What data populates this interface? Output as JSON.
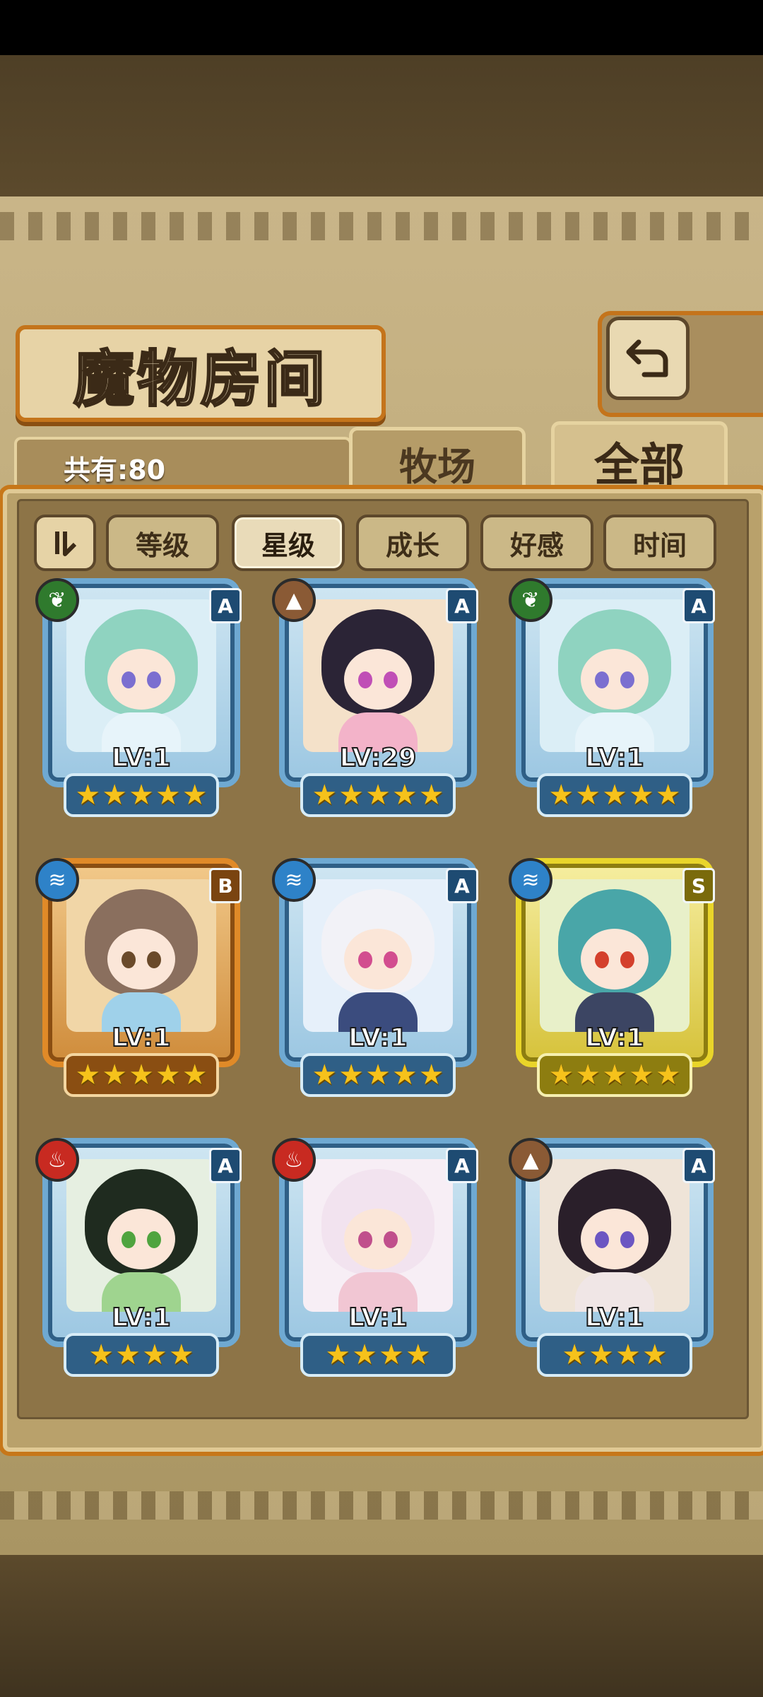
{
  "title": "魔物房间",
  "count_label": "共有:80",
  "tabs": {
    "ranch": "牧场",
    "all": "全部"
  },
  "sort_buttons": [
    "等级",
    "星级",
    "成长",
    "好感",
    "时间"
  ],
  "active_sort": "星级",
  "monsters": [
    {
      "element": "nature-icon",
      "rank": "A",
      "level": "LV:1",
      "stars": 5,
      "frame": "blue"
    },
    {
      "element": "earth-icon",
      "rank": "A",
      "level": "LV:29",
      "stars": 5,
      "frame": "blue"
    },
    {
      "element": "nature-icon",
      "rank": "A",
      "level": "LV:1",
      "stars": 5,
      "frame": "blue"
    },
    {
      "element": "water-icon",
      "rank": "B",
      "level": "LV:1",
      "stars": 5,
      "frame": "orange"
    },
    {
      "element": "water-icon",
      "rank": "A",
      "level": "LV:1",
      "stars": 5,
      "frame": "blue"
    },
    {
      "element": "water-icon",
      "rank": "S",
      "level": "LV:1",
      "stars": 5,
      "frame": "gold"
    },
    {
      "element": "fire-icon",
      "rank": "A",
      "level": "LV:1",
      "stars": 4,
      "frame": "blue"
    },
    {
      "element": "fire-icon",
      "rank": "A",
      "level": "LV:1",
      "stars": 4,
      "frame": "blue"
    },
    {
      "element": "earth-icon",
      "rank": "A",
      "level": "LV:1",
      "stars": 4,
      "frame": "blue"
    }
  ]
}
